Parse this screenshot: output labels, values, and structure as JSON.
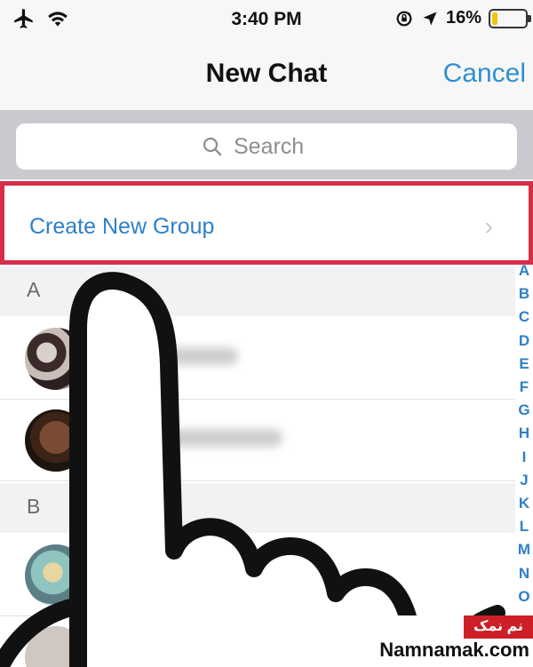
{
  "status_bar": {
    "time": "3:40 PM",
    "battery_percent": "16%",
    "battery_level": 0.16,
    "icons": [
      "airplane-icon",
      "wifi-icon",
      "rotation-lock-icon",
      "location-arrow-icon",
      "battery-icon"
    ]
  },
  "nav": {
    "title": "New Chat",
    "cancel_label": "Cancel"
  },
  "search": {
    "placeholder": "Search"
  },
  "create_group": {
    "label": "Create New Group",
    "highlight_color": "#d62d48"
  },
  "sections": [
    {
      "letter": "A"
    },
    {
      "letter": "B"
    }
  ],
  "index_letters": [
    "A",
    "B",
    "C",
    "D",
    "E",
    "F",
    "G",
    "H",
    "I",
    "J",
    "K",
    "L",
    "M",
    "N",
    "O"
  ],
  "accent_color": "#2f80c8",
  "watermark": {
    "persian": "نم نمک",
    "site": "Namnamak.com"
  }
}
